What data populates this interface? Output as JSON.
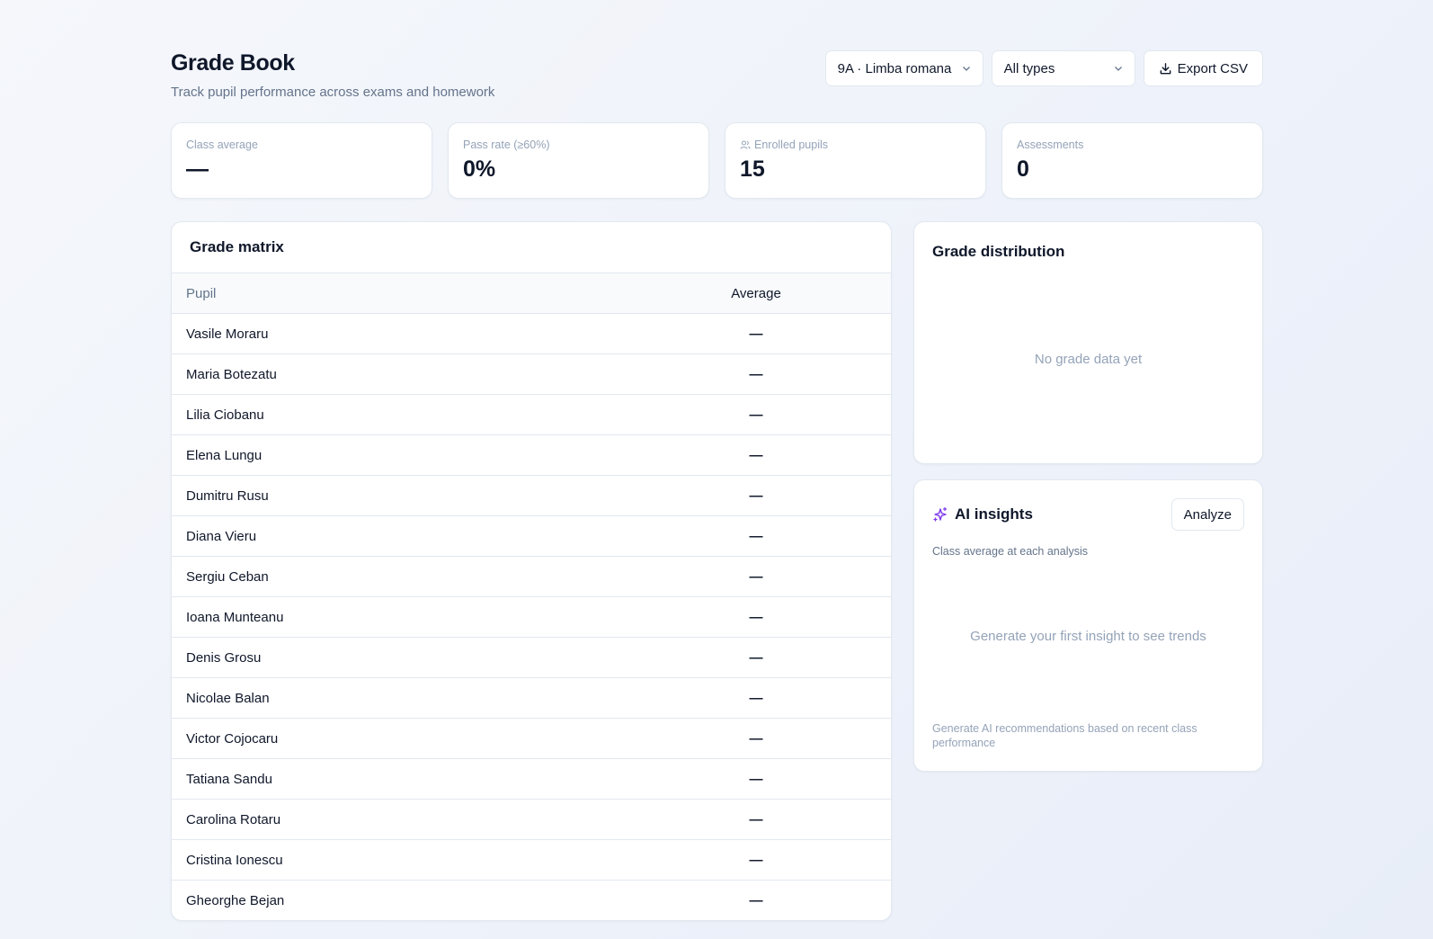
{
  "header": {
    "title": "Grade Book",
    "subtitle": "Track pupil performance across exams and homework",
    "class_select": "9A · Limba romana",
    "type_select": "All types",
    "export_label": "Export CSV"
  },
  "stats": [
    {
      "label": "Class average",
      "value": "—",
      "icon": ""
    },
    {
      "label": "Pass rate (≥60%)",
      "value": "0%",
      "icon": ""
    },
    {
      "label": "Enrolled pupils",
      "value": "15",
      "icon": "users-icon"
    },
    {
      "label": "Assessments",
      "value": "0",
      "icon": ""
    }
  ],
  "matrix": {
    "title": "Grade matrix",
    "col_pupil": "Pupil",
    "col_average": "Average",
    "rows": [
      {
        "name": "Vasile Moraru",
        "average": "—"
      },
      {
        "name": "Maria Botezatu",
        "average": "—"
      },
      {
        "name": "Lilia Ciobanu",
        "average": "—"
      },
      {
        "name": "Elena Lungu",
        "average": "—"
      },
      {
        "name": "Dumitru Rusu",
        "average": "—"
      },
      {
        "name": "Diana Vieru",
        "average": "—"
      },
      {
        "name": "Sergiu Ceban",
        "average": "—"
      },
      {
        "name": "Ioana Munteanu",
        "average": "—"
      },
      {
        "name": "Denis Grosu",
        "average": "—"
      },
      {
        "name": "Nicolae Balan",
        "average": "—"
      },
      {
        "name": "Victor Cojocaru",
        "average": "—"
      },
      {
        "name": "Tatiana Sandu",
        "average": "—"
      },
      {
        "name": "Carolina Rotaru",
        "average": "—"
      },
      {
        "name": "Cristina Ionescu",
        "average": "—"
      },
      {
        "name": "Gheorghe Bejan",
        "average": "—"
      }
    ]
  },
  "distribution": {
    "title": "Grade distribution",
    "empty": "No grade data yet"
  },
  "ai": {
    "title": "AI insights",
    "icon": "sparkles-icon",
    "analyze_label": "Analyze",
    "subtitle": "Class average at each analysis",
    "empty": "Generate your first insight to see trends",
    "footer": "Generate AI recommendations based on recent class performance"
  },
  "colors": {
    "accent": "#7c3aed",
    "text": "#0f172a",
    "muted": "#64748b",
    "border": "#e2e8f0"
  }
}
